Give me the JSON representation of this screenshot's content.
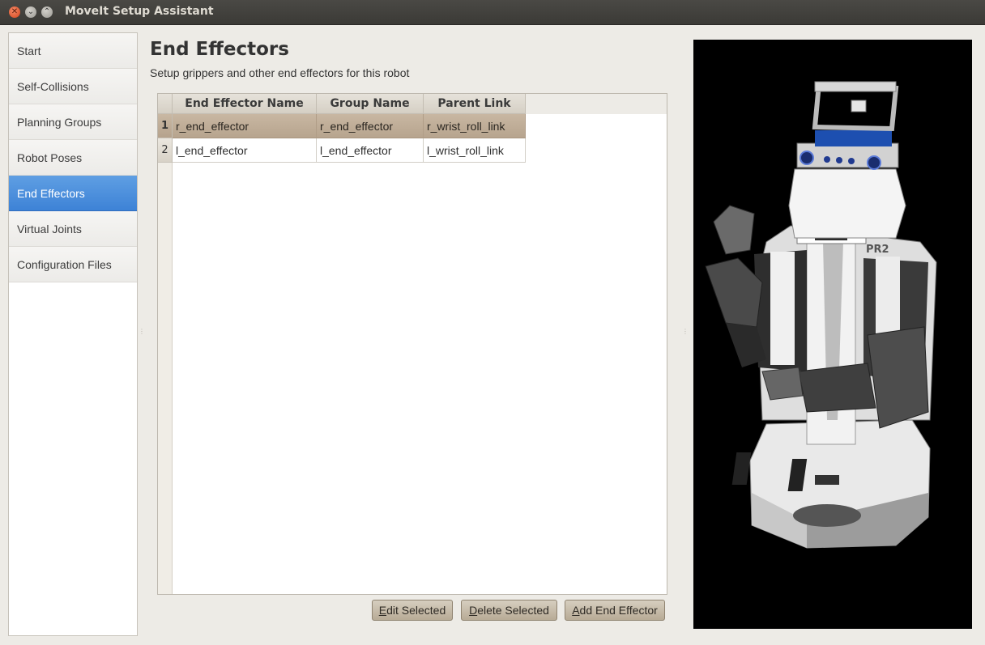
{
  "window": {
    "title": "MoveIt Setup Assistant"
  },
  "sidebar": {
    "items": [
      {
        "label": "Start"
      },
      {
        "label": "Self-Collisions"
      },
      {
        "label": "Planning Groups"
      },
      {
        "label": "Robot Poses"
      },
      {
        "label": "End Effectors",
        "active": true
      },
      {
        "label": "Virtual Joints"
      },
      {
        "label": "Configuration Files"
      }
    ]
  },
  "main": {
    "title": "End Effectors",
    "subtitle": "Setup grippers and other end effectors for this robot",
    "table": {
      "columns": [
        "End Effector Name",
        "Group Name",
        "Parent Link"
      ],
      "rows": [
        {
          "num": "1",
          "name": "r_end_effector",
          "group": "r_end_effector",
          "parent": "r_wrist_roll_link",
          "selected": true
        },
        {
          "num": "2",
          "name": "l_end_effector",
          "group": "l_end_effector",
          "parent": "l_wrist_roll_link",
          "selected": false
        }
      ]
    },
    "buttons": {
      "edit": {
        "mnemonic": "E",
        "rest": "dit Selected"
      },
      "delete": {
        "mnemonic": "D",
        "rest": "elete Selected"
      },
      "add": {
        "mnemonic": "A",
        "rest": "dd End Effector"
      }
    }
  },
  "viewer": {
    "robot_label": "PR2"
  },
  "colors": {
    "accent": "#3d82d6",
    "selection": "#b7a48e"
  }
}
